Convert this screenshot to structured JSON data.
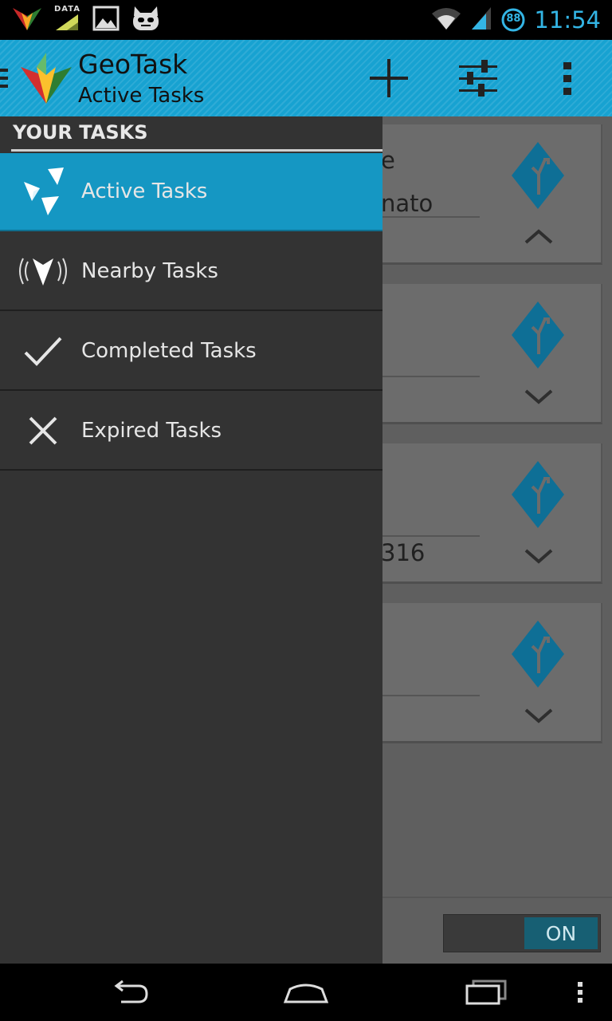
{
  "status_bar": {
    "time": "11:54",
    "battery": "88",
    "data_label": "DATA",
    "icons": [
      "geotask-notification-icon",
      "data-icon",
      "image-icon",
      "cyanogen-icon",
      "wifi-icon",
      "signal-icon",
      "battery-icon"
    ]
  },
  "action_bar": {
    "title": "GeoTask",
    "subtitle": "Active Tasks",
    "actions": [
      "add-icon",
      "filter-sliders-icon",
      "overflow-menu-icon"
    ]
  },
  "drawer": {
    "header": "YOUR TASKS",
    "items": [
      {
        "label": "Active Tasks",
        "icon": "active-tasks-icon",
        "selected": true
      },
      {
        "label": "Nearby Tasks",
        "icon": "nearby-tasks-icon",
        "selected": false
      },
      {
        "label": "Completed Tasks",
        "icon": "check-icon",
        "selected": false
      },
      {
        "label": "Expired Tasks",
        "icon": "close-icon",
        "selected": false
      }
    ]
  },
  "background_cards": [
    {
      "text_top": "e",
      "text_bottom": "nato",
      "chevron": "up"
    },
    {
      "text_top": "",
      "text_bottom": "",
      "chevron": "down"
    },
    {
      "text_top": "",
      "text_bottom": "316",
      "chevron": "down"
    },
    {
      "text_top": "",
      "text_bottom": "",
      "chevron": "down"
    }
  ],
  "toggle": {
    "label": "ON",
    "state": "on"
  },
  "colors": {
    "accent": "#17a2d1",
    "drawer_bg": "#333333",
    "selected_item": "#1597c3",
    "status_blue": "#33b5e5",
    "diamond": "#0e6f96"
  }
}
